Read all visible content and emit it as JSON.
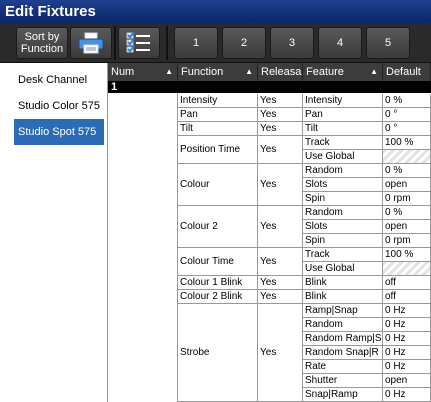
{
  "window": {
    "title": "Edit Fixtures"
  },
  "toolbar": {
    "sort_label": "Sort by\nFunction",
    "print_icon": "printer-icon",
    "checklist_icon": "checklist-icon",
    "buttons": [
      "1",
      "2",
      "3",
      "4",
      "5"
    ]
  },
  "sidebar": {
    "items": [
      {
        "label": "Desk Channel",
        "selected": false
      },
      {
        "label": "Studio Color 575",
        "selected": false
      },
      {
        "label": "Studio Spot 575",
        "selected": true
      }
    ]
  },
  "table": {
    "columns": [
      "Num",
      "Function",
      "Releasa",
      "Feature",
      "Default"
    ],
    "fixture_num": "1",
    "groups": [
      {
        "function": "Intensity",
        "release": "Yes",
        "features": [
          {
            "name": "Intensity",
            "default": "0 %"
          }
        ]
      },
      {
        "function": "Pan",
        "release": "Yes",
        "features": [
          {
            "name": "Pan",
            "default": "0 °"
          }
        ]
      },
      {
        "function": "Tilt",
        "release": "Yes",
        "features": [
          {
            "name": "Tilt",
            "default": "0 °"
          }
        ]
      },
      {
        "function": "Position Time",
        "release": "Yes",
        "features": [
          {
            "name": "Track",
            "default": "100 %"
          },
          {
            "name": "Use Global",
            "default": ""
          }
        ]
      },
      {
        "function": "Colour",
        "release": "Yes",
        "features": [
          {
            "name": "Random",
            "default": "0 %"
          },
          {
            "name": "Slots",
            "default": "open"
          },
          {
            "name": "Spin",
            "default": "0 rpm"
          }
        ]
      },
      {
        "function": "Colour 2",
        "release": "Yes",
        "features": [
          {
            "name": "Random",
            "default": "0 %"
          },
          {
            "name": "Slots",
            "default": "open"
          },
          {
            "name": "Spin",
            "default": "0 rpm"
          }
        ]
      },
      {
        "function": "Colour Time",
        "release": "Yes",
        "features": [
          {
            "name": "Track",
            "default": "100 %"
          },
          {
            "name": "Use Global",
            "default": ""
          }
        ]
      },
      {
        "function": "Colour 1 Blink",
        "release": "Yes",
        "features": [
          {
            "name": "Blink",
            "default": "off"
          }
        ]
      },
      {
        "function": "Colour 2 Blink",
        "release": "Yes",
        "features": [
          {
            "name": "Blink",
            "default": "off"
          }
        ]
      },
      {
        "function": "Strobe",
        "release": "Yes",
        "features": [
          {
            "name": "Ramp|Snap",
            "default": "0 Hz"
          },
          {
            "name": "Random",
            "default": "0 Hz"
          },
          {
            "name": "Random Ramp|S",
            "default": "0 Hz"
          },
          {
            "name": "Random Snap|R",
            "default": "0 Hz"
          },
          {
            "name": "Rate",
            "default": "0 Hz"
          },
          {
            "name": "Shutter",
            "default": "open"
          },
          {
            "name": "Snap|Ramp",
            "default": "0 Hz"
          }
        ]
      }
    ]
  }
}
